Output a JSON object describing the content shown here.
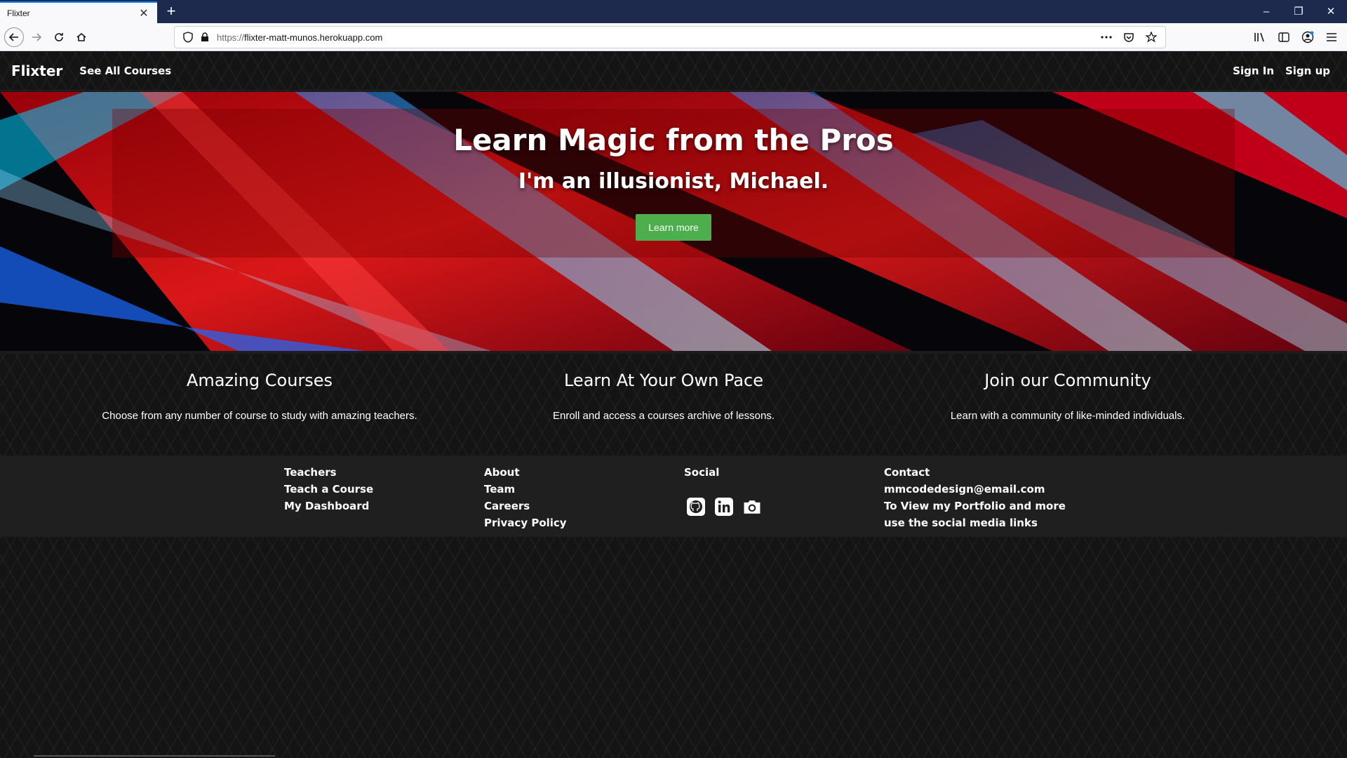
{
  "browser": {
    "tab_title": "Flixter",
    "tab_close": "✕",
    "new_tab": "+",
    "url_scheme": "https://",
    "url_host": "flixter-matt-munos.herokuapp.com",
    "window_controls": [
      "–",
      "❐",
      "✕"
    ]
  },
  "nav": {
    "brand": "Flixter",
    "see_all": "See All Courses",
    "sign_in": "Sign In",
    "sign_up": "Sign up"
  },
  "hero": {
    "title": "Learn Magic from the Pros",
    "subtitle": "I'm an illusionist, Michael.",
    "button": "Learn more",
    "accent_color": "#4cae4c"
  },
  "features": [
    {
      "title": "Amazing Courses",
      "text": "Choose from any number of course to study with amazing teachers."
    },
    {
      "title": "Learn At Your Own Pace",
      "text": "Enroll and access a courses archive of lessons."
    },
    {
      "title": "Join our Community",
      "text": "Learn with a community of like-minded individuals."
    }
  ],
  "footer": {
    "teachers": {
      "heading": "Teachers",
      "links": [
        "Teach a Course",
        "My Dashboard"
      ]
    },
    "about": {
      "heading": "About",
      "links": [
        "Team",
        "Careers",
        "Privacy Policy"
      ]
    },
    "social": {
      "heading": "Social",
      "icons": [
        "github-icon",
        "linkedin-icon",
        "instagram-icon"
      ]
    },
    "contact": {
      "heading": "Contact",
      "email": "mmcodedesign@email.com",
      "lines": [
        "To View my Portfolio and more",
        "use the social media links"
      ]
    }
  }
}
